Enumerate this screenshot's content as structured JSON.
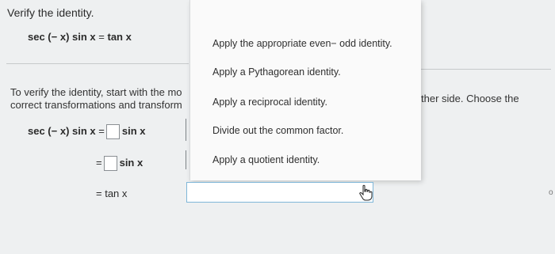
{
  "question": {
    "title": "Verify the identity.",
    "equation": {
      "lhs": "sec (− x) sin x",
      "eq": "=",
      "rhs": "tan x"
    }
  },
  "instruction": {
    "line1": "To verify the identity, start with the mo",
    "line2": "correct transformations and transform",
    "right_fragment": "ther side. Choose the"
  },
  "work": {
    "row1": {
      "lhs": "sec (− x) sin x",
      "eq": "=",
      "after": "sin x"
    },
    "row2": {
      "eq": "=",
      "after": "sin x"
    },
    "row3": {
      "text": "= tan x"
    }
  },
  "dropdown": {
    "options": [
      "Apply the appropriate even− odd identity.",
      "Apply a Pythagorean identity.",
      "Apply a reciprocal identity.",
      "Divide out the common factor.",
      "Apply a quotient identity."
    ]
  },
  "edge_mark": "o"
}
